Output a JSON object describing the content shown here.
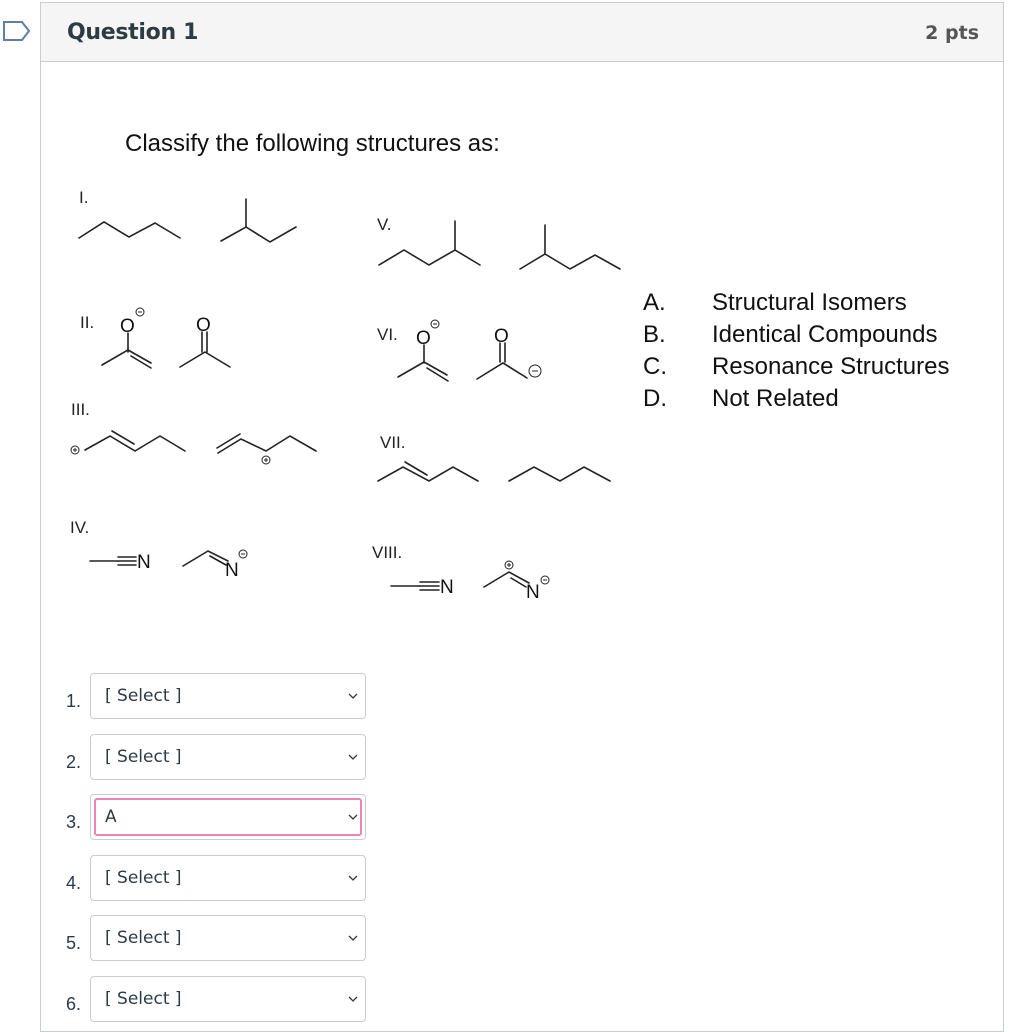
{
  "question": {
    "title": "Question 1",
    "points": "2 pts",
    "prompt": "Classify the following structures as:"
  },
  "structures": [
    {
      "label": "I.",
      "left": "pentane",
      "right": "2-methylbutane"
    },
    {
      "label": "II.",
      "left": "enolate (O⊖)",
      "right": "acetone"
    },
    {
      "label": "III.",
      "left": "allylic cation (terminal ⊕)",
      "right": "allylic cation (internal ⊕)"
    },
    {
      "label": "IV.",
      "left": "acetonitrile (C≡N)",
      "right": "imine anion (N⊖)"
    },
    {
      "label": "V.",
      "left": "2-methylpentane",
      "right": "2-methylpentane"
    },
    {
      "label": "VI.",
      "left": "enolate (O⊖)",
      "right": "acetone carbanion (⊖)"
    },
    {
      "label": "VII.",
      "left": "2-pentene",
      "right": "pentane"
    },
    {
      "label": "VIII.",
      "left": "acetonitrile (C≡N)",
      "right": "nitrilium zwitterion (⊕/N⊖)"
    }
  ],
  "chem_text": {
    "O": "O",
    "N": "N",
    "EN": "N",
    "minus": "⊖",
    "plus": "⊕"
  },
  "choices": [
    {
      "letter": "A.",
      "text": "Structural Isomers"
    },
    {
      "letter": "B.",
      "text": "Identical Compounds"
    },
    {
      "letter": "C.",
      "text": "Resonance Structures"
    },
    {
      "letter": "D.",
      "text": "Not Related"
    }
  ],
  "answers": [
    {
      "num": "1.",
      "value": "[ Select ]"
    },
    {
      "num": "2.",
      "value": "[ Select ]"
    },
    {
      "num": "3.",
      "value": "A"
    },
    {
      "num": "4.",
      "value": "[ Select ]"
    },
    {
      "num": "5.",
      "value": "[ Select ]"
    },
    {
      "num": "6.",
      "value": "[ Select ]"
    }
  ],
  "colors": {
    "focus_border": "#ec84b6",
    "header_bg": "#f5f5f5",
    "title_text": "#2d3b45"
  }
}
